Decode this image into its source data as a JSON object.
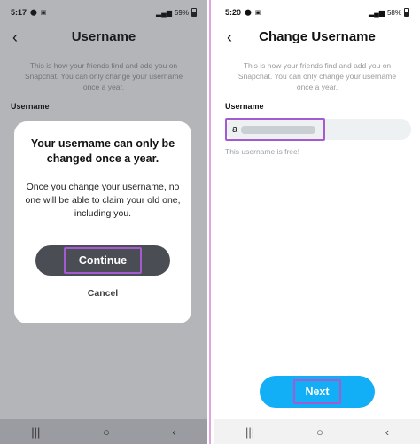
{
  "left_screen": {
    "status": {
      "time": "5:17",
      "battery": "59%"
    },
    "header": {
      "title": "Username"
    },
    "subtitle": "This is how your friends find and add you on Snapchat. You can only change your username once a year.",
    "field_label": "Username",
    "dialog": {
      "title": "Your username can only be changed once a year.",
      "body": "Once you change your username, no one will be able to claim your old one, including you.",
      "continue_label": "Continue",
      "cancel_label": "Cancel"
    },
    "nav": {
      "recents": "|||",
      "home": "○",
      "back": "‹"
    }
  },
  "right_screen": {
    "status": {
      "time": "5:20",
      "battery": "58%"
    },
    "header": {
      "title": "Change Username"
    },
    "subtitle": "This is how your friends find and add you on Snapchat. You can only change your username once a year.",
    "field_label": "Username",
    "input": {
      "value": "a"
    },
    "helper_text": "This username is free!",
    "next_label": "Next",
    "nav": {
      "recents": "|||",
      "home": "○",
      "back": "‹"
    }
  },
  "colors": {
    "highlight": "#a45bd1",
    "next_button": "#12aef6",
    "continue_button": "#4a4d53"
  }
}
